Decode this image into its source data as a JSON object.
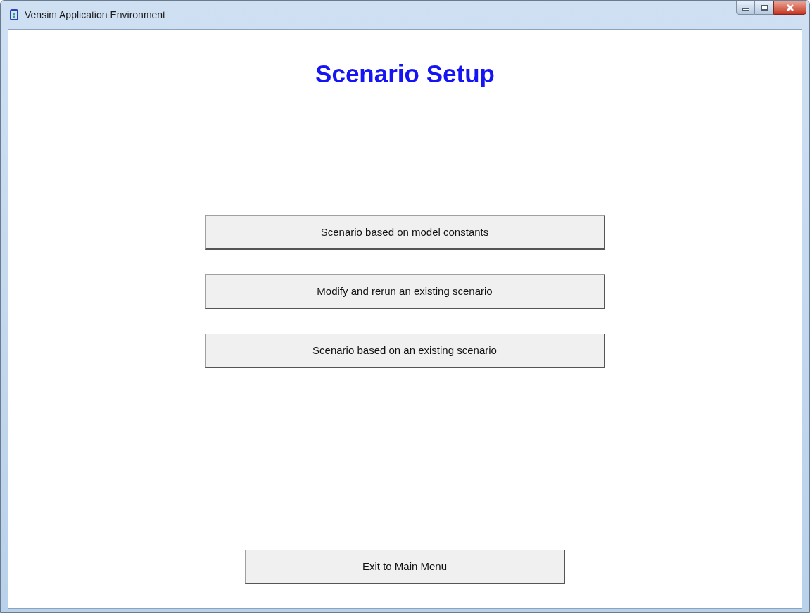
{
  "window": {
    "title": "Vensim Application Environment"
  },
  "heading": "Scenario Setup",
  "options": [
    "Scenario based on model constants",
    "Modify and rerun an existing scenario",
    "Scenario based on an existing scenario"
  ],
  "exit_button": "Exit to Main Menu"
}
